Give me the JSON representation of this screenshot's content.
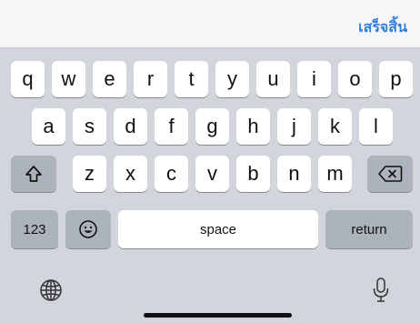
{
  "toolbar": {
    "done_label": "เสร็จสิ้น"
  },
  "keyboard": {
    "row1": [
      "q",
      "w",
      "e",
      "r",
      "t",
      "y",
      "u",
      "i",
      "o",
      "p"
    ],
    "row2": [
      "a",
      "s",
      "d",
      "f",
      "g",
      "h",
      "j",
      "k",
      "l"
    ],
    "row3": [
      "z",
      "x",
      "c",
      "v",
      "b",
      "n",
      "m"
    ],
    "shift_icon": "shift-icon",
    "delete_icon": "delete-icon",
    "numbers_label": "123",
    "emoji_icon": "emoji-icon",
    "space_label": "space",
    "return_label": "return",
    "globe_icon": "globe-icon",
    "mic_icon": "microphone-icon"
  },
  "colors": {
    "accent": "#2f7fdc",
    "keyboard_bg": "#d2d5db",
    "key_bg": "#ffffff",
    "dark_key_bg": "#adb3bc"
  }
}
